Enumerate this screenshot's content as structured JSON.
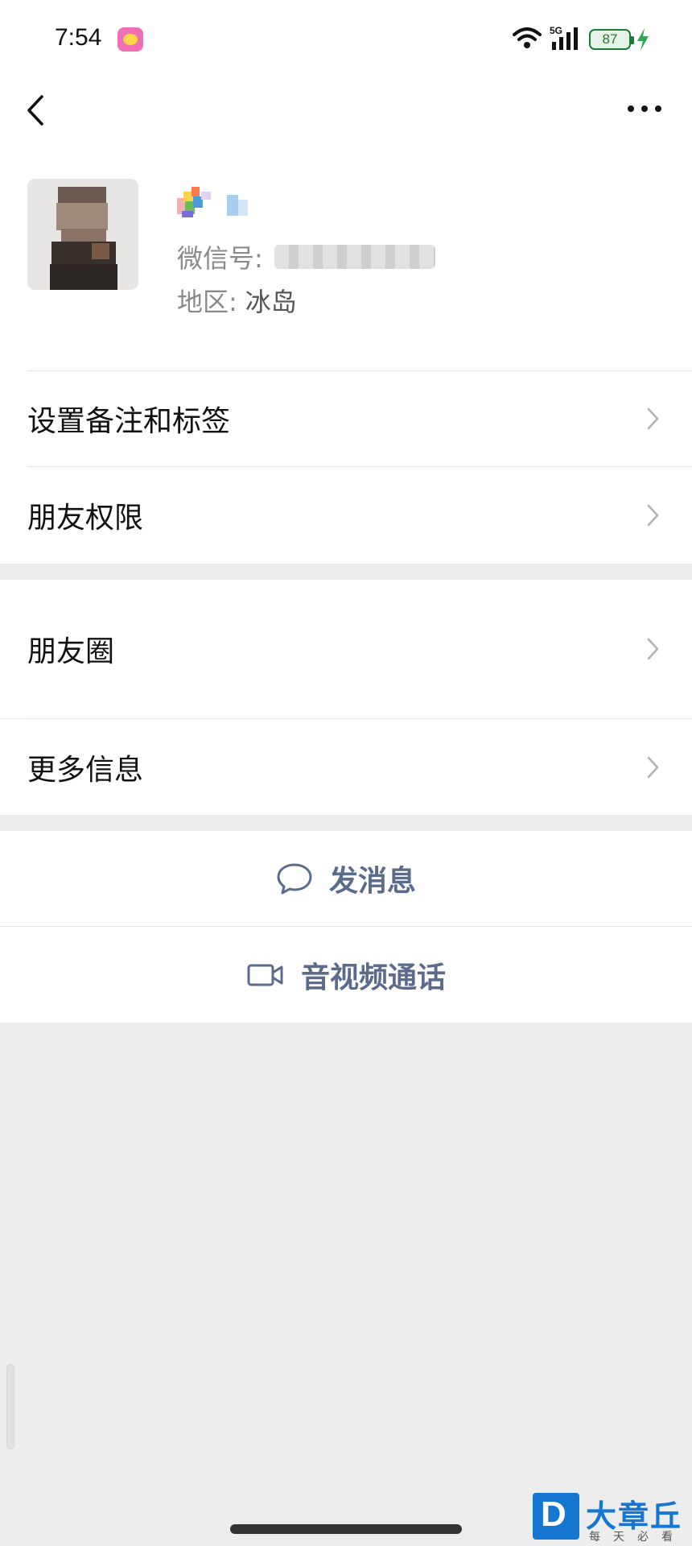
{
  "status_bar": {
    "time": "7:54",
    "network": "5G",
    "battery_level": "87",
    "icons": [
      "app-notification-icon",
      "wifi-icon",
      "signal-icon",
      "battery-icon",
      "charging-bolt-icon"
    ]
  },
  "navigation": {
    "back_icon": "chevron-left-icon",
    "more_icon": "more-dots-icon"
  },
  "profile": {
    "wechat_id_label": "微信号:",
    "region_label": "地区:",
    "region_value": "冰岛"
  },
  "menu": {
    "remarks_tags": "设置备注和标签",
    "friend_permissions": "朋友权限",
    "moments": "朋友圈",
    "more_info": "更多信息"
  },
  "actions": {
    "send_message": "发消息",
    "send_message_icon": "chat-bubble-icon",
    "av_call": "音视频通话",
    "av_call_icon": "video-camera-icon"
  },
  "watermark": {
    "logo_letter": "D",
    "title": "大章丘",
    "subtitle": "每天必看"
  },
  "colors": {
    "page_background": "#ededed",
    "card_background": "#ffffff",
    "action_text": "#5b6b8c",
    "secondary_text": "#8a8a8a",
    "battery_green": "#1e7a36",
    "watermark_blue": "#1677d2"
  }
}
